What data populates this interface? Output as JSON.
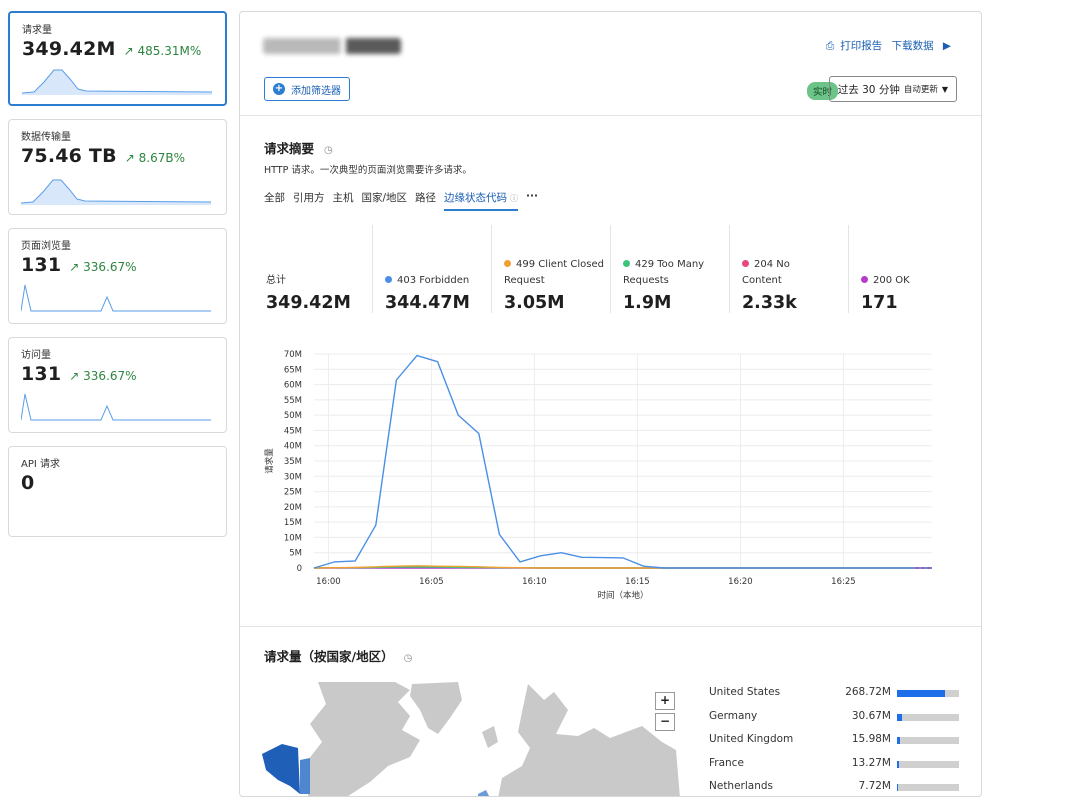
{
  "cards": [
    {
      "title": "请求量",
      "value": "349.42M",
      "delta": "↗ 485.31M%"
    },
    {
      "title": "数据传输量",
      "value": "75.46 TB",
      "delta": "↗ 8.67B%"
    },
    {
      "title": "页面浏览量",
      "value": "131",
      "delta": "↗ 336.67%"
    },
    {
      "title": "访问量",
      "value": "131",
      "delta": "↗ 336.67%"
    },
    {
      "title": "API 请求",
      "value": "0",
      "delta": ""
    }
  ],
  "header": {
    "print_report": "打印报告",
    "download_data": "下载数据",
    "add_filter": "添加筛选器",
    "live_badge": "实时",
    "range_label": "过去 30 分钟",
    "auto_refresh": "自动更新"
  },
  "summary": {
    "title": "请求摘要",
    "description": "HTTP 请求。一次典型的页面浏览需要许多请求。",
    "tabs": [
      "全部",
      "引用方",
      "主机",
      "国家/地区",
      "路径",
      "边缘状态代码"
    ],
    "more": "···",
    "stats": [
      {
        "label": "总计",
        "value": "349.42M",
        "color": ""
      },
      {
        "label": "403 Forbidden",
        "value": "344.47M",
        "color": "#4a8fe6"
      },
      {
        "label": "499 Client Closed Request",
        "value": "3.05M",
        "color": "#f0a030"
      },
      {
        "label": "429 Too Many Requests",
        "value": "1.9M",
        "color": "#3cc47c"
      },
      {
        "label": "204 No Content",
        "value": "2.33k",
        "color": "#e8467c"
      },
      {
        "label": "200 OK",
        "value": "171",
        "color": "#b43cc8"
      }
    ]
  },
  "chart_data": {
    "type": "line",
    "xlabel": "时间（本地）",
    "ylabel": "请求量",
    "ylim": [
      0,
      70
    ],
    "yunit": "M",
    "x_ticks": [
      "16:00",
      "16:05",
      "16:10",
      "16:15",
      "16:20",
      "16:25"
    ],
    "y_ticks": [
      "0",
      "5M",
      "10M",
      "15M",
      "20M",
      "25M",
      "30M",
      "35M",
      "40M",
      "45M",
      "50M",
      "55M",
      "60M",
      "65M",
      "70M"
    ],
    "x": [
      -0.7,
      0.3,
      1.3,
      2.3,
      3.3,
      4.3,
      5.3,
      6.3,
      7.3,
      8.3,
      9.3,
      10.3,
      11.3,
      12.3,
      13.3,
      14.3,
      15.3,
      16.3,
      17.3,
      18.3,
      19.3,
      20.3,
      21.3,
      22.3,
      23.3,
      24.3,
      25.3,
      26.3,
      27.3,
      28.3,
      29.3
    ],
    "series": [
      {
        "name": "403 Forbidden",
        "color": "#4a8fe6",
        "values": [
          0,
          2,
          2.3,
          14,
          61.5,
          69.5,
          67.5,
          50,
          44,
          11,
          2,
          4,
          5,
          3.5,
          3.4,
          3.3,
          0.6,
          0,
          0,
          0,
          0,
          0,
          0,
          0,
          0,
          0,
          0,
          0,
          0,
          0,
          0
        ]
      },
      {
        "name": "499 Client Closed Request",
        "color": "#f0a030",
        "values": [
          0,
          0.1,
          0.2,
          0.4,
          0.6,
          0.7,
          0.6,
          0.5,
          0.4,
          0.2,
          0.1,
          0,
          0,
          0,
          0,
          0,
          0,
          0,
          0,
          0,
          0,
          0,
          0,
          0,
          0,
          0,
          0,
          0,
          0,
          0,
          0
        ]
      },
      {
        "name": "429 Too Many Requests",
        "color": "#3cc47c",
        "values": [
          0,
          0.1,
          0.1,
          0.2,
          0.3,
          0.3,
          0.3,
          0.2,
          0.2,
          0.1,
          0.1,
          0,
          0,
          0,
          0,
          0,
          0,
          0,
          0,
          0,
          0,
          0,
          0,
          0,
          0,
          0,
          0,
          0,
          0,
          0,
          0
        ]
      },
      {
        "name": "200 OK",
        "color": "#b43cc8",
        "values": [
          0,
          0,
          0,
          0,
          0,
          0,
          0,
          0,
          0,
          0,
          0,
          0,
          0,
          0,
          0,
          0,
          0,
          0,
          0,
          0,
          0,
          0,
          0,
          0,
          0,
          0,
          0,
          0,
          0,
          0,
          0
        ]
      }
    ]
  },
  "country_section": {
    "title": "请求量（按国家/地区）",
    "zoom_in": "+",
    "zoom_out": "−",
    "rows": [
      {
        "country": "United States",
        "value": "268.72M",
        "share": 0.769
      },
      {
        "country": "Germany",
        "value": "30.67M",
        "share": 0.088
      },
      {
        "country": "United Kingdom",
        "value": "15.98M",
        "share": 0.046
      },
      {
        "country": "France",
        "value": "13.27M",
        "share": 0.038
      },
      {
        "country": "Netherlands",
        "value": "7.72M",
        "share": 0.022
      }
    ]
  },
  "colors": {
    "accent": "#2c7cd1",
    "positive": "#2e8540",
    "live": "#6cc489"
  }
}
